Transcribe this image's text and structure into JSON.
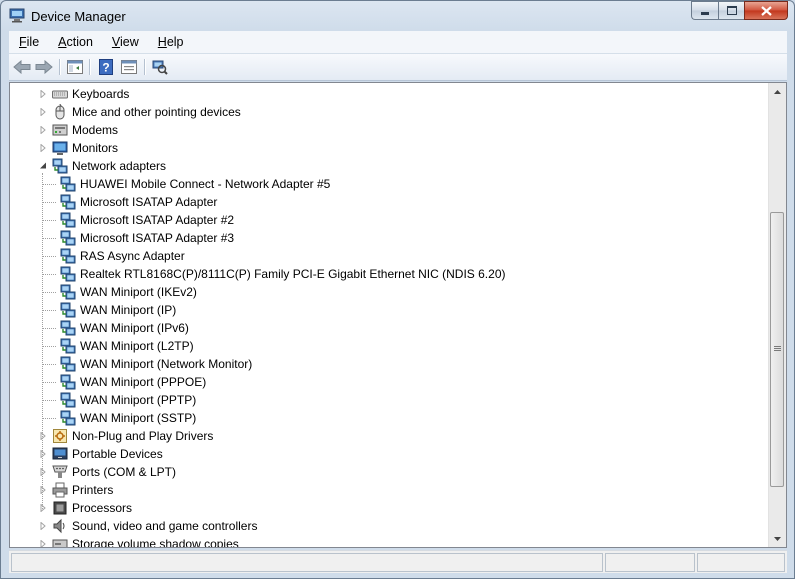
{
  "window": {
    "title": "Device Manager"
  },
  "menu": [
    {
      "label": "File",
      "mnemonic": "F",
      "rest": "ile"
    },
    {
      "label": "Action",
      "mnemonic": "A",
      "rest": "ction"
    },
    {
      "label": "View",
      "mnemonic": "V",
      "rest": "iew"
    },
    {
      "label": "Help",
      "mnemonic": "H",
      "rest": "elp"
    }
  ],
  "toolbar": [
    "back-icon",
    "forward-icon",
    "show-hide-console-tree-icon",
    "help-icon",
    "properties-icon",
    "scan-hardware-changes-icon"
  ],
  "tree": {
    "categories_top": [
      {
        "label": "Keyboards",
        "icon": "keyboard-icon",
        "expanded": false
      },
      {
        "label": "Mice and other pointing devices",
        "icon": "mouse-icon",
        "expanded": false
      },
      {
        "label": "Modems",
        "icon": "modem-icon",
        "expanded": false
      },
      {
        "label": "Monitors",
        "icon": "monitor-icon",
        "expanded": false
      },
      {
        "label": "Network adapters",
        "icon": "network-adapter-icon",
        "expanded": true
      }
    ],
    "network_adapters": [
      "HUAWEI Mobile Connect - Network Adapter #5",
      "Microsoft ISATAP Adapter",
      "Microsoft ISATAP Adapter #2",
      "Microsoft ISATAP Adapter #3",
      "RAS Async Adapter",
      "Realtek RTL8168C(P)/8111C(P) Family PCI-E Gigabit Ethernet NIC (NDIS 6.20)",
      "WAN Miniport (IKEv2)",
      "WAN Miniport (IP)",
      "WAN Miniport (IPv6)",
      "WAN Miniport (L2TP)",
      "WAN Miniport (Network Monitor)",
      "WAN Miniport (PPPOE)",
      "WAN Miniport (PPTP)",
      "WAN Miniport (SSTP)"
    ],
    "categories_bottom": [
      {
        "label": "Non-Plug and Play Drivers",
        "icon": "non-plug-and-play-icon"
      },
      {
        "label": "Portable Devices",
        "icon": "portable-devices-icon"
      },
      {
        "label": "Ports (COM & LPT)",
        "icon": "ports-icon"
      },
      {
        "label": "Printers",
        "icon": "printer-icon"
      },
      {
        "label": "Processors",
        "icon": "processor-icon"
      },
      {
        "label": "Sound, video and game controllers",
        "icon": "sound-icon"
      },
      {
        "label": "Storage volume shadow copies",
        "icon": "storage-icon"
      }
    ]
  }
}
